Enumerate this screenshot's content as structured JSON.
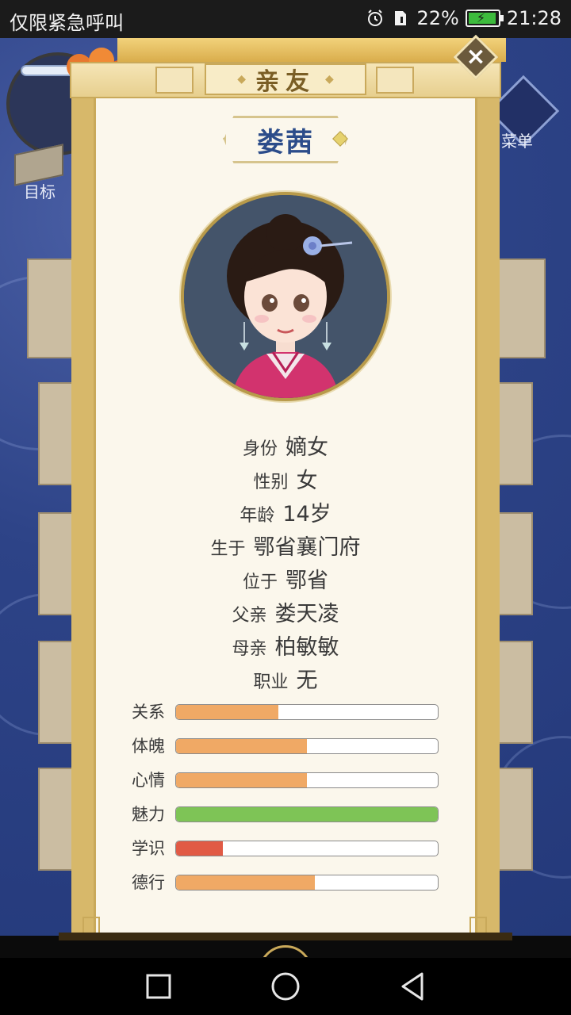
{
  "status_bar": {
    "carrier_text": "仅限紧急呼叫",
    "battery": "22%",
    "time": "21:28"
  },
  "background": {
    "menu_label": "菜单",
    "goal_label": "目标"
  },
  "dialog": {
    "title": "亲友",
    "name": "娄茜"
  },
  "info": [
    {
      "key": "身份",
      "value": "嫡女"
    },
    {
      "key": "性别",
      "value": "女"
    },
    {
      "key": "年龄",
      "value": "14岁"
    },
    {
      "key": "生于",
      "value": "鄂省襄门府"
    },
    {
      "key": "位于",
      "value": "鄂省"
    },
    {
      "key": "父亲",
      "value": "娄天凌"
    },
    {
      "key": "母亲",
      "value": "柏敏敏"
    },
    {
      "key": "职业",
      "value": "无"
    }
  ],
  "stats": [
    {
      "label": "关系",
      "level": 0.39,
      "color": "#f0a965"
    },
    {
      "label": "体魄",
      "level": 0.5,
      "color": "#f0a965"
    },
    {
      "label": "心情",
      "level": 0.5,
      "color": "#f0a965"
    },
    {
      "label": "魅力",
      "level": 1.0,
      "color": "#7ec456"
    },
    {
      "label": "学识",
      "level": 0.18,
      "color": "#e15a45"
    },
    {
      "label": "德行",
      "level": 0.53,
      "color": "#f0a965"
    }
  ]
}
